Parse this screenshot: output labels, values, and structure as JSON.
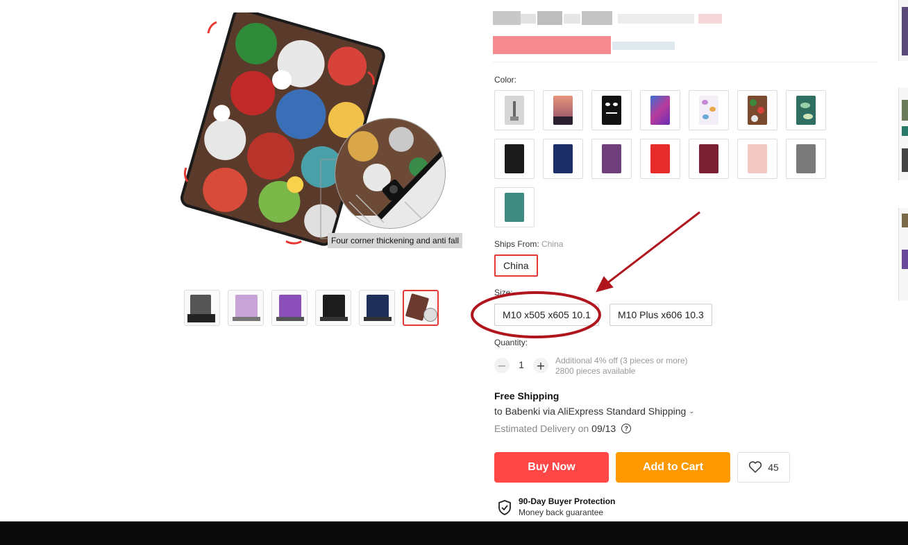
{
  "main_image": {
    "caption": "Four corner thickening and anti fall"
  },
  "thumbnails": [
    {
      "name": "graffiti-set",
      "color": "#555555"
    },
    {
      "name": "butterfly-stand",
      "color": "#b48ad2"
    },
    {
      "name": "galaxy-stand",
      "color": "#8a4fb8"
    },
    {
      "name": "black-stand",
      "color": "#1c1c1c"
    },
    {
      "name": "navy-stand",
      "color": "#1f2f5a"
    },
    {
      "name": "graffiti-selected",
      "color": "#6a3b2e"
    }
  ],
  "color_section": {
    "label": "Color:",
    "options": [
      {
        "name": "eiffel-tower",
        "color": "#c9c9c9"
      },
      {
        "name": "sunset-city",
        "color": "#d08a6a"
      },
      {
        "name": "dont-touch-me",
        "color": "#111111"
      },
      {
        "name": "galaxy",
        "color": "#7e4bb8"
      },
      {
        "name": "butterflies",
        "color": "#c7a3d8"
      },
      {
        "name": "graffiti",
        "color": "#7a4a2f"
      },
      {
        "name": "green-leaves",
        "color": "#2f6f62"
      },
      {
        "name": "black",
        "color": "#1a1a1a"
      },
      {
        "name": "navy",
        "color": "#1d2f66"
      },
      {
        "name": "purple",
        "color": "#6e3f7a"
      },
      {
        "name": "red",
        "color": "#e62b2b"
      },
      {
        "name": "wine",
        "color": "#7a1f33"
      },
      {
        "name": "pink",
        "color": "#f2c9c4"
      },
      {
        "name": "gray",
        "color": "#7a7a7a"
      },
      {
        "name": "teal",
        "color": "#3f8a80"
      }
    ]
  },
  "ships_from": {
    "label": "Ships From:",
    "value_text": "China",
    "options": [
      "China"
    ]
  },
  "size_section": {
    "label": "Size:",
    "options": [
      "M10 x505 x605 10.1",
      "M10 Plus x606 10.3"
    ]
  },
  "quantity": {
    "label": "Quantity:",
    "minus": "−",
    "value": "1",
    "plus": "+",
    "discount_note": "Additional 4% off (3 pieces or more)",
    "available": "2800 pieces available"
  },
  "shipping": {
    "title": "Free Shipping",
    "destination": "to Babenki via AliExpress Standard Shipping",
    "delivery_label": "Estimated Delivery on",
    "delivery_date": "09/13"
  },
  "actions": {
    "buy_now": "Buy Now",
    "add_to_cart": "Add to Cart",
    "wishlist_count": "45"
  },
  "protection": {
    "title": "90-Day Buyer Protection",
    "subtitle": "Money back guarantee"
  },
  "colors": {
    "accent_red": "#ff4747",
    "cart_orange": "#ff9900",
    "annotation_red": "#b0151e"
  }
}
